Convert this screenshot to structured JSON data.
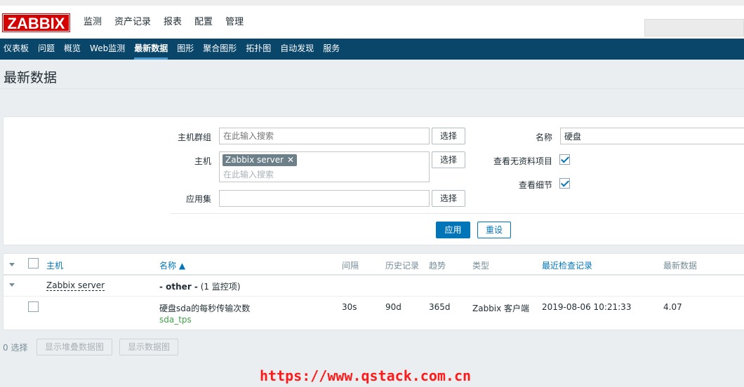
{
  "logo": "ZABBIX",
  "top_menu": [
    "监测",
    "资产记录",
    "报表",
    "配置",
    "管理"
  ],
  "sub_menu": [
    "仪表板",
    "问题",
    "概览",
    "Web监测",
    "最新数据",
    "图形",
    "聚合图形",
    "拓扑图",
    "自动发现",
    "服务"
  ],
  "page_title": "最新数据",
  "filter": {
    "host_group_label": "主机群组",
    "host_group_placeholder": "在此输入搜索",
    "host_label": "主机",
    "host_tag": "Zabbix server",
    "host_placeholder": "在此输入搜索",
    "app_label": "应用集",
    "select_label": "选择",
    "name_label": "名称",
    "name_value": "硬盘",
    "show_no_data_label": "查看无资料项目",
    "show_no_data_checked": true,
    "show_details_label": "查看细节",
    "show_details_checked": true,
    "apply_label": "应用",
    "reset_label": "重设"
  },
  "table": {
    "headers": {
      "host": "主机",
      "name": "名称 ▲",
      "interval": "间隔",
      "history": "历史记录",
      "trends": "趋势",
      "type": "类型",
      "last_check": "最近检查记录",
      "last_value": "最新数据"
    },
    "group": {
      "host": "Zabbix server",
      "label": "- other -",
      "count": " (1 监控项)"
    },
    "rows": [
      {
        "name": "硬盘sda的每秒传输次数",
        "key": "sda_tps",
        "interval": "30s",
        "history": "90d",
        "trends": "365d",
        "type": "Zabbix 客户端",
        "last_check": "2019-08-06 10:21:33",
        "last_value": "4.07"
      }
    ]
  },
  "footer": {
    "selected": "0 选择",
    "stacked_graph": "显示堆叠数据图",
    "graph": "显示数据图"
  },
  "watermark": "https://www.qstack.com.cn",
  "colors": {
    "brand_red": "#d40000",
    "nav_blue": "#0a466a",
    "link_blue": "#0275b8",
    "key_green": "#429e47",
    "watermark_red": "#ff1a1a"
  }
}
